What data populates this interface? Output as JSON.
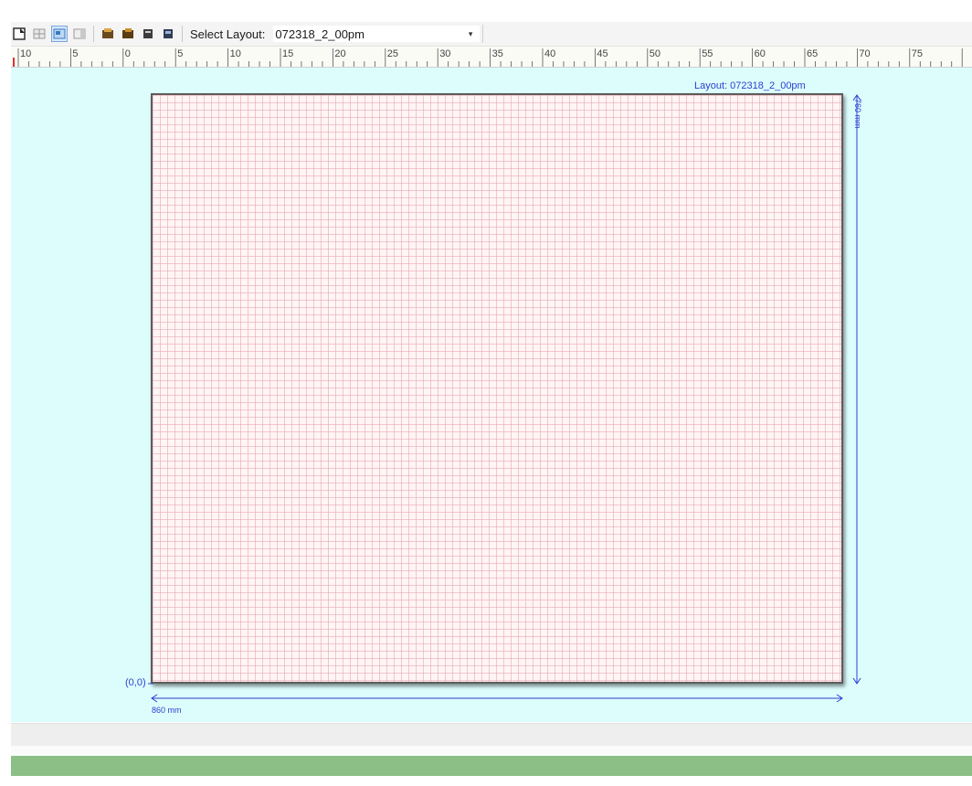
{
  "toolbar": {
    "buttons": [
      {
        "icon": "new-layout-icon",
        "active": false
      },
      {
        "icon": "grid-view-icon",
        "active": false
      },
      {
        "icon": "board-view-icon",
        "active": true
      },
      {
        "icon": "side-panel-icon",
        "active": false
      },
      {
        "icon": "component-icon-1",
        "active": false
      },
      {
        "icon": "component-icon-2",
        "active": false
      },
      {
        "icon": "component-icon-3",
        "active": false
      },
      {
        "icon": "component-icon-4",
        "active": false
      }
    ],
    "select_label": "Select Layout:",
    "select_value": "072318_2_00pm",
    "select_arrow": "▾"
  },
  "ruler": {
    "labels": [
      "10",
      "5",
      "0",
      "5",
      "10",
      "15",
      "20",
      "25",
      "30",
      "35",
      "40",
      "45",
      "50",
      "55",
      "60",
      "65",
      "70",
      "75"
    ]
  },
  "canvas": {
    "layout_title": "Layout: 072318_2_00pm",
    "width_label": "860 mm",
    "height_label": "760 mm",
    "origin_label": "(0,0)",
    "board_fill": "#fff5f5",
    "grid_color": "#e6a0af",
    "dimension_color": "#2b3fd0",
    "background": "#ddfdfd"
  },
  "status": {
    "progress_color": "#8bbf85"
  }
}
